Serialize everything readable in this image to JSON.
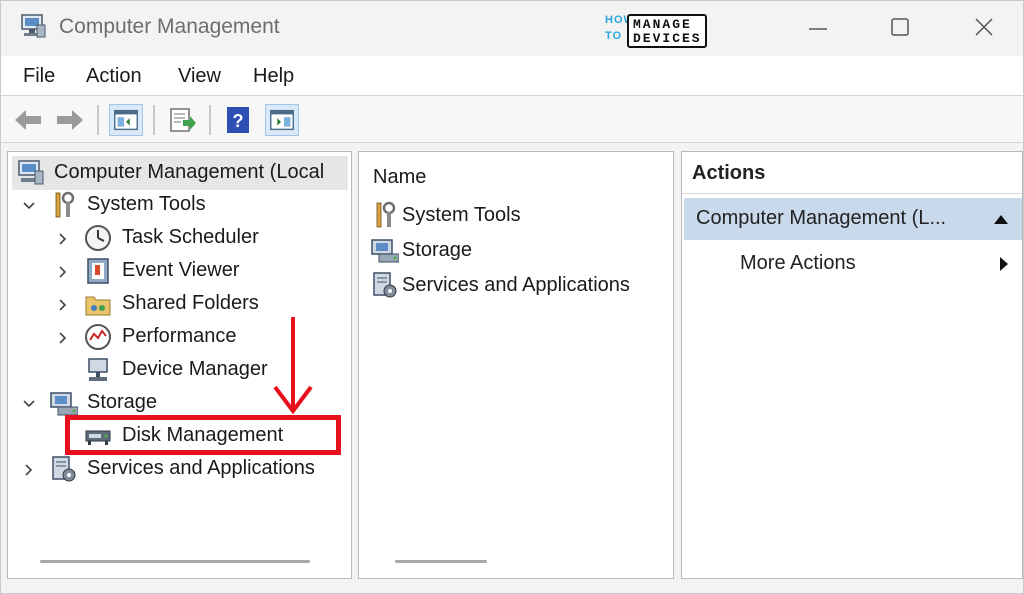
{
  "window": {
    "title": "Computer Management",
    "logo": {
      "how": "HOW",
      "to": "TO",
      "manage": "MANAGE",
      "devices": "DEVICES"
    }
  },
  "menu": {
    "file": "File",
    "action": "Action",
    "view": "View",
    "help": "Help"
  },
  "toolbar": {
    "icons": [
      "back-arrow-icon",
      "forward-arrow-icon",
      "show-hide-console-tree-icon",
      "export-list-icon",
      "help-icon",
      "show-hide-action-pane-icon"
    ]
  },
  "tree": {
    "root": "Computer Management (Local",
    "system_tools": "System Tools",
    "task_scheduler": "Task Scheduler",
    "event_viewer": "Event Viewer",
    "shared_folders": "Shared Folders",
    "performance": "Performance",
    "device_manager": "Device Manager",
    "storage": "Storage",
    "disk_management": "Disk Management",
    "services_apps": "Services and Applications"
  },
  "list": {
    "column_name": "Name",
    "items": [
      "System Tools",
      "Storage",
      "Services and Applications"
    ]
  },
  "actions": {
    "title": "Actions",
    "section": "Computer Management (L...",
    "more_actions": "More Actions"
  },
  "colors": {
    "highlight": "#e8101c",
    "action_section_bg": "#c7d9ea",
    "logo_blue": "#2aa6df"
  }
}
